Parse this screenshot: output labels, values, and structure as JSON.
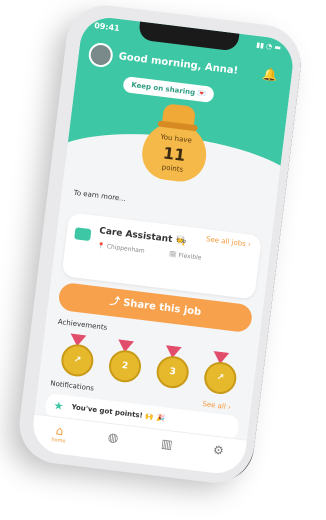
{
  "status_bar": {
    "time": "09:41",
    "icons": "▮▮ ◔ ▬"
  },
  "header": {
    "greeting": "Good morning, Anna!",
    "pill_label": "Keep on sharing 💌",
    "points_prefix": "You have",
    "points_value": "11",
    "points_suffix": "points"
  },
  "jobs": {
    "section_label": "To earn more...",
    "see_all_label": "See all jobs",
    "title": "Care Assistant 🧑‍🍳",
    "location": "Chippenham",
    "type": "Flexible",
    "share_button_label": "Share this job"
  },
  "achievements": {
    "section_label": "Achievements",
    "medals": [
      "↗",
      "2",
      "3",
      "↗"
    ]
  },
  "notifications": {
    "section_label": "Notifications",
    "see_all_label": "See all",
    "item_text": "You've got points! 🙌 🎉"
  },
  "tabbar": {
    "items": [
      {
        "label": "home",
        "icon": "house-icon"
      },
      {
        "label": "",
        "icon": "money-icon"
      },
      {
        "label": "",
        "icon": "buildings-icon"
      },
      {
        "label": "",
        "icon": "settings-icon"
      }
    ]
  }
}
